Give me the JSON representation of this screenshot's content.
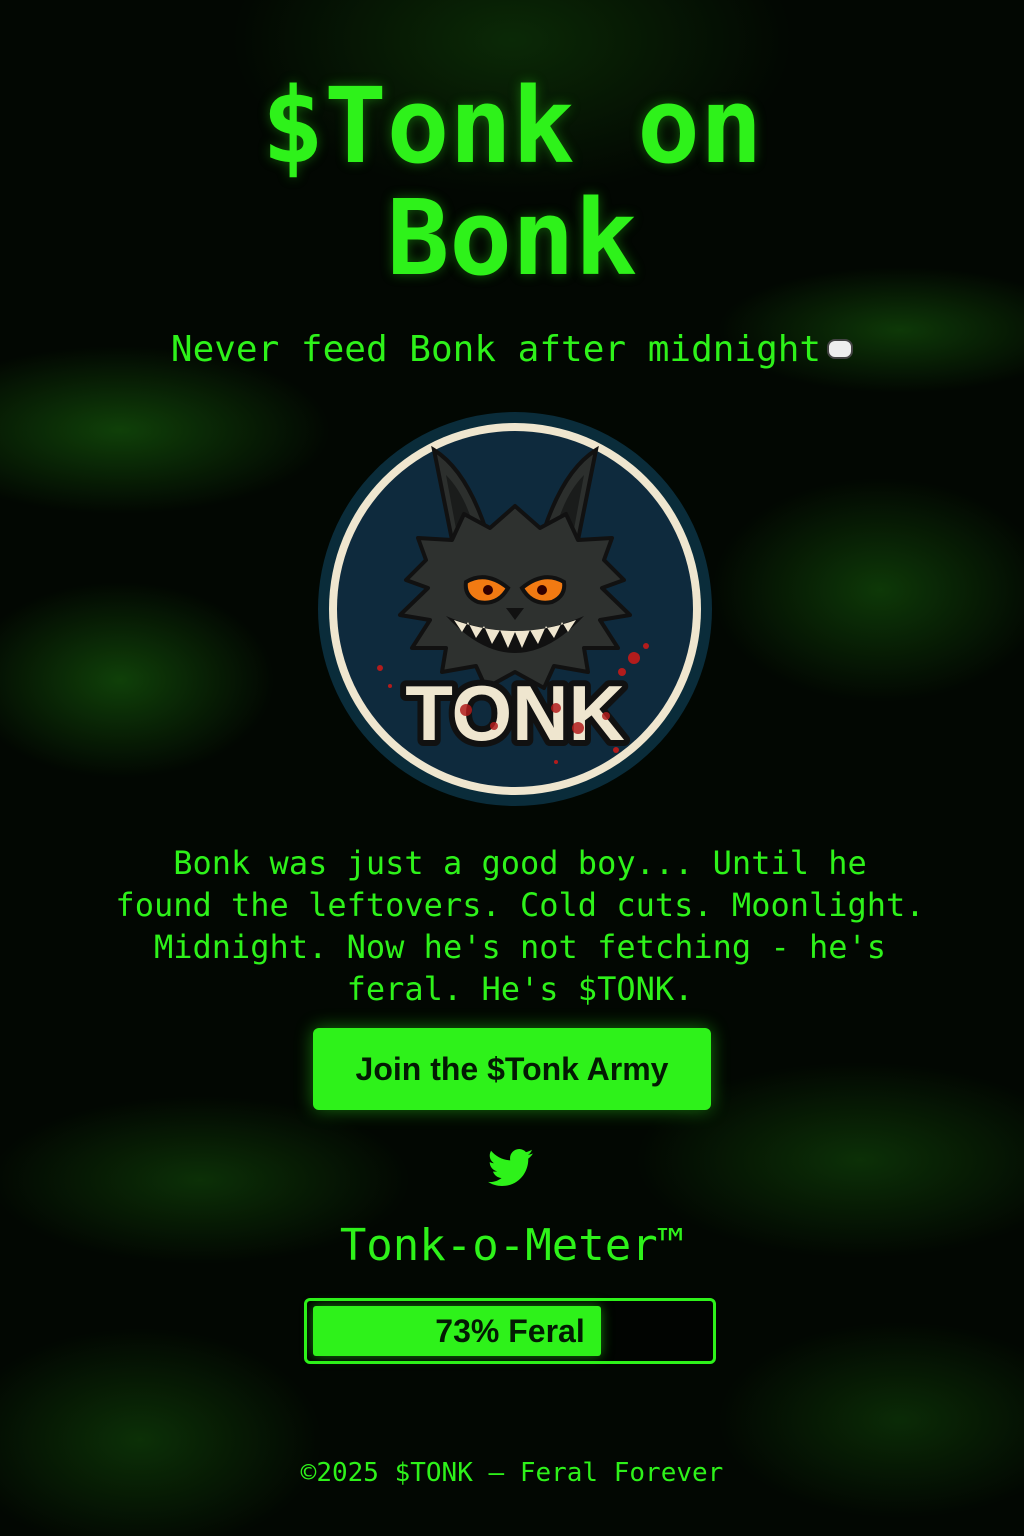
{
  "header": {
    "title_line1": "$Tonk on",
    "title_line2": "Bonk",
    "tagline": "Never feed Bonk after midnight"
  },
  "logo": {
    "text": "TONK",
    "icon": "feral-bonk-monster-logo"
  },
  "story": {
    "line1": "Bonk was just a good boy... Until he",
    "line2": "found the leftovers. Cold cuts. Moonlight.",
    "line3": "Midnight. Now he's not fetching - he's",
    "line4": "feral. He's $TONK."
  },
  "cta": {
    "label": "Join the $Tonk Army"
  },
  "social": {
    "icon": "twitter-icon"
  },
  "meter": {
    "title": "Tonk-o-Meter™",
    "label": "73% Feral",
    "value_percent": 73
  },
  "footer": {
    "text": "©2025 $TONK – Feral Forever"
  },
  "colors": {
    "accent": "#2ef21a",
    "background": "#020702",
    "logo_bg": "#0e2a3d",
    "eyes": "#f27a12"
  }
}
